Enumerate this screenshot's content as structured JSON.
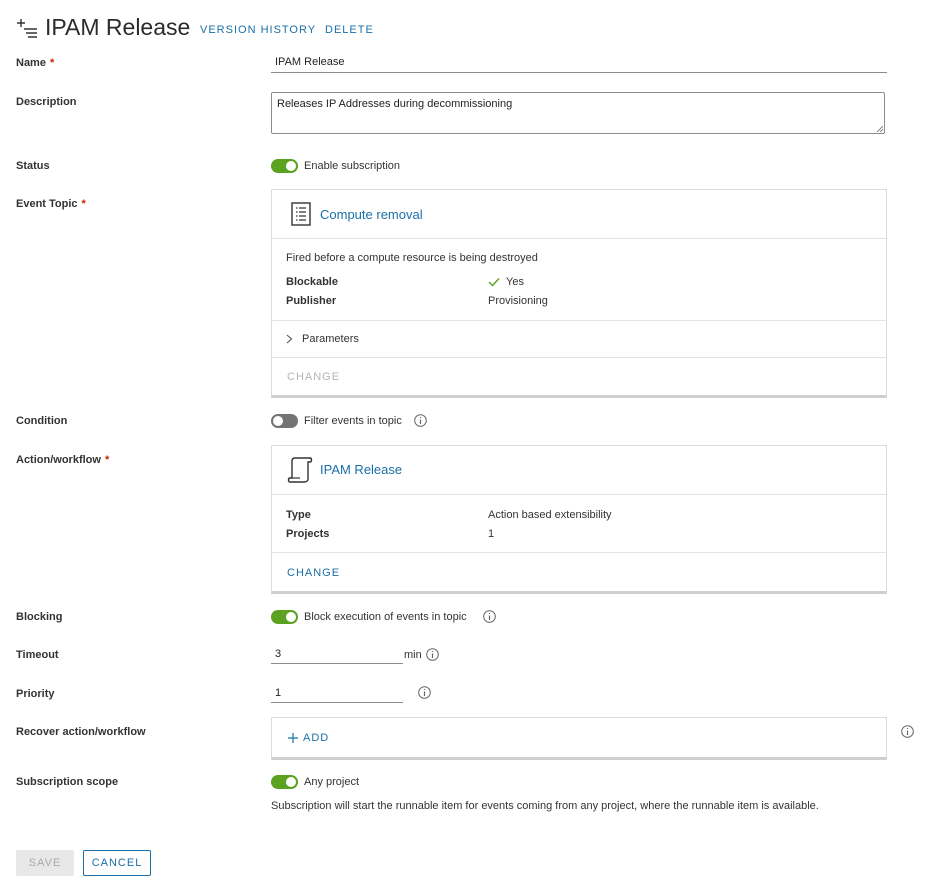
{
  "header": {
    "title": "IPAM Release",
    "version_history": "VERSION HISTORY",
    "delete": "DELETE",
    "icon": "subscription-add-icon"
  },
  "form": {
    "name": {
      "label": "Name",
      "required": "*",
      "value": "IPAM Release"
    },
    "description": {
      "label": "Description",
      "value": "Releases IP Addresses during decommissioning"
    },
    "status": {
      "label": "Status",
      "toggle_label": "Enable subscription",
      "enabled": true
    },
    "event_topic": {
      "label": "Event Topic",
      "required": "*",
      "card": {
        "title": "Compute removal",
        "icon": "document-list-icon",
        "description": "Fired before a compute resource is being destroyed",
        "rows": [
          {
            "key": "Blockable",
            "value": "Yes"
          },
          {
            "key": "Publisher",
            "value": "Provisioning"
          }
        ],
        "parameters": "Parameters",
        "change": "CHANGE"
      }
    },
    "condition": {
      "label": "Condition",
      "toggle_label": "Filter events in topic",
      "enabled": false
    },
    "action_workflow": {
      "label": "Action/workflow",
      "required": "*",
      "card": {
        "title": "IPAM Release",
        "icon": "script-icon",
        "rows": [
          {
            "key": "Type",
            "value": "Action based extensibility"
          },
          {
            "key": "Projects",
            "value": "1"
          }
        ],
        "change": "CHANGE"
      }
    },
    "blocking": {
      "label": "Blocking",
      "toggle_label": "Block execution of events in topic",
      "enabled": true
    },
    "timeout": {
      "label": "Timeout",
      "value": "3",
      "unit": "min"
    },
    "priority": {
      "label": "Priority",
      "value": "1"
    },
    "recover": {
      "label": "Recover action/workflow",
      "add": "ADD"
    },
    "scope": {
      "label": "Subscription scope",
      "toggle_label": "Any project",
      "enabled": true,
      "help": "Subscription will start the runnable item for events coming from any project, where the runnable item is available."
    }
  },
  "footer": {
    "save": "SAVE",
    "cancel": "CANCEL"
  },
  "colors": {
    "accent": "#1b6fa8",
    "toggle_on": "#5aa220",
    "toggle_off": "#747474",
    "required": "#c92100"
  }
}
